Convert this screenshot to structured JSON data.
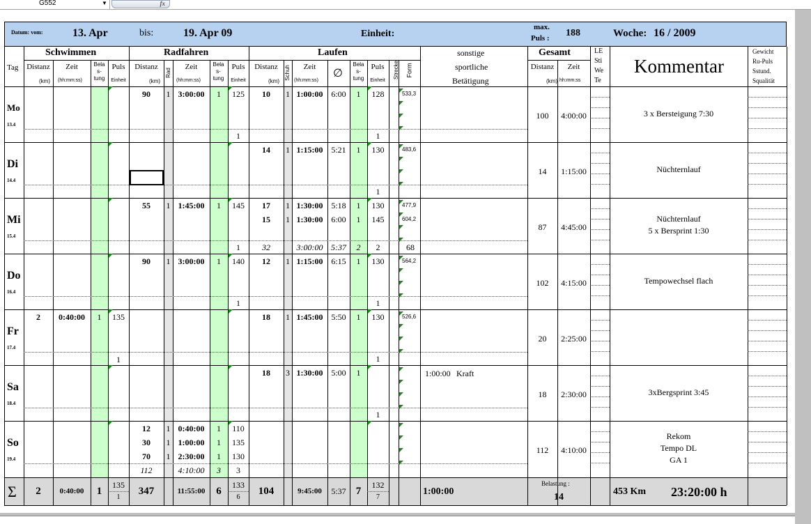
{
  "excel": {
    "name_box": "G552",
    "fx": "fx"
  },
  "header": {
    "datum_label": "Datum: vom:",
    "from": "13. Apr",
    "bis_label": "bis:",
    "to": "19. Apr  09",
    "einheit_label": "Einheit:",
    "maxpuls_label1": "max.",
    "maxpuls_label2": "Puls :",
    "maxpuls": "188",
    "woche_label": "Woche:",
    "woche": "16 / 2009"
  },
  "cols": {
    "tag": "Tag",
    "schwimmen": "Schwimmen",
    "radfahren": "Radfahren",
    "laufen": "Laufen",
    "sonstige1": "sonstige",
    "sonstige2": "sportliche",
    "sonstige3": "Betätigung",
    "gesamt": "Gesamt",
    "le": [
      "LE",
      "Sti",
      "We",
      "Te"
    ],
    "kommentar": "Kommentar",
    "gewicht": [
      "Gewicht",
      "Ru-Puls",
      "Sstund.",
      "Squalität"
    ],
    "distanz": "Distanz",
    "zeit": "Zeit",
    "km": "(km)",
    "hms": "(hh:mm:ss)",
    "hms2": "hh:mm:ss",
    "bela": [
      "Bela",
      "s-",
      "tung"
    ],
    "puls": "Puls",
    "einheit": "Einheit",
    "rad": "Rad",
    "schuh": "Schuh",
    "avg": "∅",
    "strecke": "Strecke",
    "form": "Form"
  },
  "days": [
    {
      "name": "Mo",
      "date": "13.4",
      "rad": [
        [
          "90",
          "1",
          "3:00:00",
          "1",
          "125"
        ]
      ],
      "lauf": [
        [
          "10",
          "1",
          "1:00:00",
          "6:00",
          "1",
          "128"
        ]
      ],
      "form": [
        "533,3"
      ],
      "r_sum": "1",
      "l_sum": "1",
      "ges_dist": "100",
      "ges_zeit": "4:00:00",
      "komm": [
        "3 x Bersteigung 7:30"
      ]
    },
    {
      "name": "Di",
      "date": "14.4",
      "rad": [],
      "lauf": [
        [
          "14",
          "1",
          "1:15:00",
          "5:21",
          "1",
          "130"
        ]
      ],
      "form": [
        "483,6"
      ],
      "l_sum": "1",
      "ges_dist": "14",
      "ges_zeit": "1:15:00",
      "komm": [
        "Nüchternlauf"
      ]
    },
    {
      "name": "Mi",
      "date": "15.4",
      "rad": [
        [
          "55",
          "1",
          "1:45:00",
          "1",
          "145"
        ]
      ],
      "lauf": [
        [
          "17",
          "1",
          "1:30:00",
          "5:18",
          "1",
          "130"
        ],
        [
          "15",
          "1",
          "1:30:00",
          "6:00",
          "1",
          "145"
        ]
      ],
      "form": [
        "477,9",
        "604,2"
      ],
      "r_sum": "1",
      "lsum_it": [
        "32",
        "3:00:00",
        "5:37",
        "2"
      ],
      "l_sum": "2",
      "form_sum": "68",
      "ges_dist": "87",
      "ges_zeit": "4:45:00",
      "komm": [
        "Nüchternlauf",
        "5 x Bersprint 1:30"
      ]
    },
    {
      "name": "Do",
      "date": "16.4",
      "rad": [
        [
          "90",
          "1",
          "3:00:00",
          "1",
          "140"
        ]
      ],
      "lauf": [
        [
          "12",
          "1",
          "1:15:00",
          "6:15",
          "1",
          "130"
        ]
      ],
      "form": [
        "564,2"
      ],
      "r_sum": "1",
      "l_sum": "1",
      "ges_dist": "102",
      "ges_zeit": "4:15:00",
      "komm": [
        "Tempowechsel flach"
      ]
    },
    {
      "name": "Fr",
      "date": "17.4",
      "swim": [
        "2",
        "0:40:00",
        "1",
        "135"
      ],
      "s_sum": "1",
      "lauf": [
        [
          "18",
          "1",
          "1:45:00",
          "5:50",
          "1",
          "130"
        ]
      ],
      "form": [
        "526,6"
      ],
      "l_sum": "1",
      "ges_dist": "20",
      "ges_zeit": "2:25:00",
      "komm": []
    },
    {
      "name": "Sa",
      "date": "18.4",
      "lauf": [
        [
          "18",
          "3",
          "1:30:00",
          "5:00",
          "1",
          ""
        ]
      ],
      "sonst": [
        "1:00:00",
        "Kraft"
      ],
      "l_sum": "1",
      "ges_dist": "18",
      "ges_zeit": "2:30:00",
      "komm": [
        "3xBergsprint 3:45"
      ]
    },
    {
      "name": "So",
      "date": "19.4",
      "rad": [
        [
          "12",
          "1",
          "0:40:00",
          "1",
          "110"
        ],
        [
          "30",
          "1",
          "1:00:00",
          "1",
          "135"
        ],
        [
          "70",
          "1",
          "2:30:00",
          "1",
          "130"
        ]
      ],
      "rsum_it": [
        "112",
        "4:10:00",
        "3"
      ],
      "r_sum": "3",
      "ges_dist": "112",
      "ges_zeit": "4:10:00",
      "komm": [
        "Rekom",
        "Tempo DL",
        "GA 1"
      ]
    }
  ],
  "sum": {
    "sigma": "Σ",
    "s_dist": "2",
    "s_zeit": "0:40:00",
    "s_bel": "1",
    "s_puls": "135",
    "s_puls2": "1",
    "r_dist": "347",
    "r_zeit": "11:55:00",
    "r_bel": "6",
    "r_puls": "133",
    "r_puls2": "6",
    "l_dist": "104",
    "l_zeit": "9:45:00",
    "l_avg": "5:37",
    "l_bel": "7",
    "l_puls": "132",
    "l_puls2": "7",
    "sonst": "1:00:00",
    "bel_label": "Belastung :",
    "bel": "14",
    "km": "453 Km",
    "h": "23:20:00 h"
  }
}
